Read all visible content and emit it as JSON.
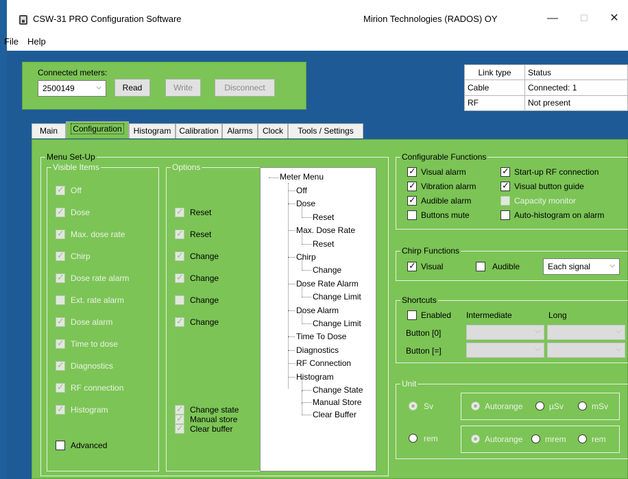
{
  "window": {
    "title": "CSW-31 PRO Configuration Software",
    "company": "Mirion Technologies (RADOS) OY",
    "controls": {
      "minimize": "—",
      "maximize": "☐",
      "close": "✕"
    }
  },
  "menu": [
    "File",
    "Help"
  ],
  "connection": {
    "label": "Connected meters:",
    "meter": "2500149",
    "buttons": {
      "read": "Read",
      "write": "Write",
      "disconnect": "Disconnect"
    }
  },
  "link_table": {
    "headers": [
      "Link type",
      "Status"
    ],
    "rows": [
      [
        "Cable",
        "Connected: 1"
      ],
      [
        "RF",
        "Not present"
      ]
    ]
  },
  "tabs": [
    "Main",
    "Configuration",
    "Histogram",
    "Calibration",
    "Alarms",
    "Clock",
    "Tools / Settings"
  ],
  "menu_setup": {
    "title": "Menu Set-Up",
    "visible_title": "Visible Items",
    "options_title": "Options",
    "visible_items": [
      {
        "label": "Off",
        "checked": true
      },
      {
        "label": "Dose",
        "checked": true
      },
      {
        "label": "Max. dose rate",
        "checked": true
      },
      {
        "label": "Chirp",
        "checked": true
      },
      {
        "label": "Dose rate alarm",
        "checked": true
      },
      {
        "label": "Ext. rate alarm",
        "checked": false
      },
      {
        "label": "Dose alarm",
        "checked": true
      },
      {
        "label": "Time to dose",
        "checked": true
      },
      {
        "label": "Diagnostics",
        "checked": true
      },
      {
        "label": "RF connection",
        "checked": true
      },
      {
        "label": "Histogram",
        "checked": true
      },
      {
        "label": "Advanced",
        "checked": false
      }
    ],
    "options": [
      {
        "label": "Reset",
        "checked": true
      },
      {
        "label": "Reset",
        "checked": true
      },
      {
        "label": "Change",
        "checked": true
      },
      {
        "label": "Change",
        "checked": true
      },
      {
        "label": "Change",
        "checked": false
      },
      {
        "label": "Change",
        "checked": true
      },
      {
        "label": "Change state",
        "checked": true
      },
      {
        "label": "Manual store",
        "checked": true
      },
      {
        "label": "Clear buffer",
        "checked": true
      }
    ]
  },
  "meter_tree": {
    "root": "Meter Menu",
    "items": [
      {
        "label": "Off",
        "level": 1
      },
      {
        "label": "Dose",
        "level": 1
      },
      {
        "label": "Reset",
        "level": 2
      },
      {
        "label": "Max. Dose Rate",
        "level": 1
      },
      {
        "label": "Reset",
        "level": 2
      },
      {
        "label": "Chirp",
        "level": 1
      },
      {
        "label": "Change",
        "level": 2
      },
      {
        "label": "Dose Rate Alarm",
        "level": 1
      },
      {
        "label": "Change Limit",
        "level": 2
      },
      {
        "label": "Dose Alarm",
        "level": 1
      },
      {
        "label": "Change Limit",
        "level": 2
      },
      {
        "label": "Time To Dose",
        "level": 1
      },
      {
        "label": "Diagnostics",
        "level": 1
      },
      {
        "label": "RF Connection",
        "level": 1
      },
      {
        "label": "Histogram",
        "level": 1
      },
      {
        "label": "Change State",
        "level": 2
      },
      {
        "label": "Manual Store",
        "level": 2
      },
      {
        "label": "Clear Buffer",
        "level": 2
      }
    ]
  },
  "configurable_functions": {
    "title": "Configurable Functions",
    "items": [
      {
        "label": "Visual alarm",
        "checked": true,
        "enabled": true
      },
      {
        "label": "Start-up RF connection",
        "checked": true,
        "enabled": true
      },
      {
        "label": "Vibration alarm",
        "checked": true,
        "enabled": true
      },
      {
        "label": "Visual button guide",
        "checked": true,
        "enabled": true
      },
      {
        "label": "Audible alarm",
        "checked": true,
        "enabled": true
      },
      {
        "label": "Capacity monitor",
        "checked": false,
        "enabled": false
      },
      {
        "label": "Buttons mute",
        "checked": false,
        "enabled": true
      },
      {
        "label": "Auto-histogram on alarm",
        "checked": false,
        "enabled": true
      }
    ]
  },
  "chirp_functions": {
    "title": "Chirp Functions",
    "visual": {
      "label": "Visual",
      "checked": true
    },
    "audible": {
      "label": "Audible",
      "checked": false
    },
    "mode": "Each signal"
  },
  "shortcuts": {
    "title": "Shortcuts",
    "enabled_label": "Enabled",
    "enabled": false,
    "col_intermediate": "Intermediate",
    "col_long": "Long",
    "rows": [
      "Button [0]",
      "Button [=]"
    ]
  },
  "unit": {
    "title": "Unit",
    "sv": "Sv",
    "rem": "rem",
    "sv_row": {
      "autorange": "Autorange",
      "opt1": "µSv",
      "opt2": "mSv"
    },
    "rem_row": {
      "autorange": "Autorange",
      "opt1": "mrem",
      "opt2": "rem"
    }
  }
}
